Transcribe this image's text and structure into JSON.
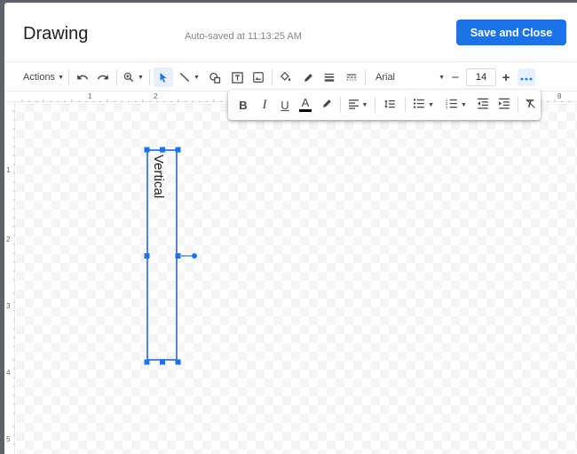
{
  "header": {
    "title": "Drawing",
    "autosave": "Auto-saved at 11:13:25 AM",
    "save_close_label": "Save and Close"
  },
  "toolbar": {
    "actions_label": "Actions",
    "font": "Arial",
    "font_size": "14"
  },
  "ruler": {
    "top_numbers": [
      "1",
      "2",
      "8"
    ],
    "left_numbers": [
      "1",
      "2",
      "3",
      "4",
      "5"
    ]
  },
  "canvas": {
    "textbox_text": "Vertical"
  },
  "colors": {
    "accent": "#1a73e8",
    "selection": "#4285f4"
  }
}
